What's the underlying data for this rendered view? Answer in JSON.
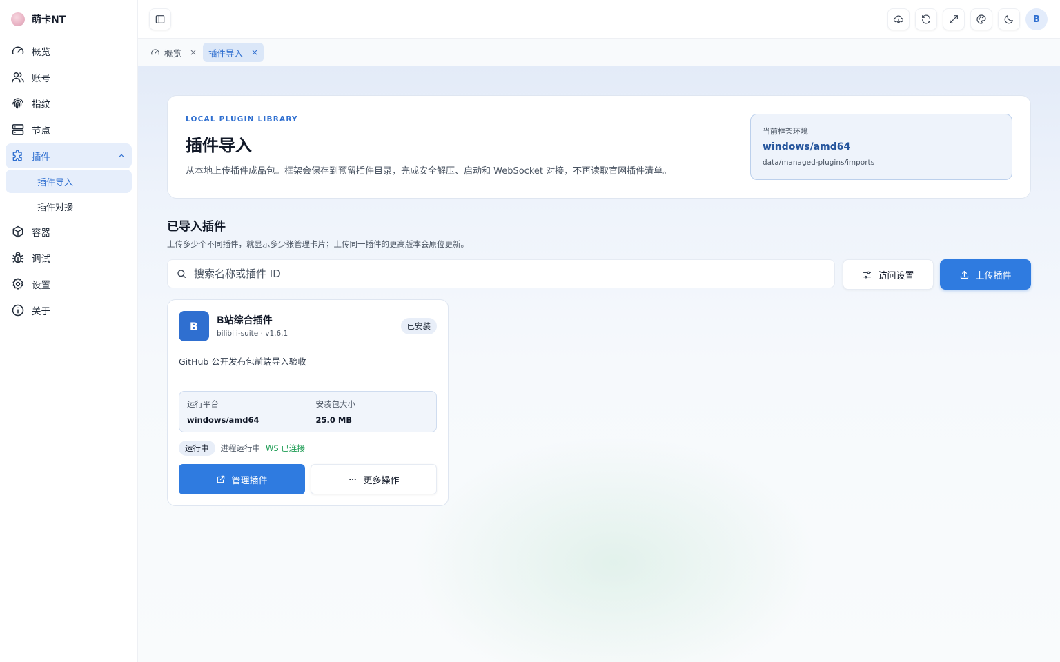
{
  "app": {
    "name": "萌卡NT"
  },
  "sidebar": {
    "items": [
      {
        "label": "概览",
        "icon": "gauge-icon"
      },
      {
        "label": "账号",
        "icon": "users-icon"
      },
      {
        "label": "指纹",
        "icon": "fingerprint-icon"
      },
      {
        "label": "节点",
        "icon": "server-icon"
      },
      {
        "label": "插件",
        "icon": "puzzle-icon",
        "expanded": true,
        "children": [
          {
            "label": "插件导入",
            "active": true
          },
          {
            "label": "插件对接"
          }
        ]
      },
      {
        "label": "容器",
        "icon": "box-icon"
      },
      {
        "label": "调试",
        "icon": "bug-icon"
      },
      {
        "label": "设置",
        "icon": "gear-icon"
      },
      {
        "label": "关于",
        "icon": "info-icon"
      }
    ]
  },
  "topbar": {
    "actions": [
      "cloud-download-icon",
      "refresh-icon",
      "fullscreen-icon",
      "palette-icon",
      "moon-icon"
    ],
    "avatar_letter": "B"
  },
  "tabs": [
    {
      "label": "概览",
      "close": "×",
      "active": false
    },
    {
      "label": "插件导入",
      "close": "×",
      "active": true
    }
  ],
  "hero": {
    "kicker": "LOCAL PLUGIN LIBRARY",
    "title": "插件导入",
    "description": "从本地上传插件成品包。框架会保存到预留插件目录，完成安全解压、启动和 WebSocket 对接，不再读取官网插件清单。",
    "env": {
      "label": "当前框架环境",
      "value": "windows/amd64",
      "path": "data/managed-plugins/imports"
    }
  },
  "section": {
    "title": "已导入插件",
    "description": "上传多少个不同插件，就显示多少张管理卡片；上传同一插件的更高版本会原位更新。"
  },
  "search": {
    "placeholder": "搜索名称或插件 ID",
    "value": ""
  },
  "buttons": {
    "access_settings": "访问设置",
    "upload_plugin": "上传插件"
  },
  "plugins": [
    {
      "logo_letter": "B",
      "name": "B站综合插件",
      "meta": "bilibili-suite · v1.6.1",
      "installed_badge": "已安装",
      "description": "GitHub 公开发布包前端导入验收",
      "platform_label": "运行平台",
      "platform": "windows/amd64",
      "size_label": "安装包大小",
      "size": "25.0 MB",
      "status": "运行中",
      "process_status": "进程运行中",
      "ws_status": "WS 已连接",
      "manage_label": "管理插件",
      "more_label": "更多操作"
    }
  ],
  "colors": {
    "accent": "#2f6fd0",
    "primary_button": "#2f7be0",
    "success": "#1f9d55"
  }
}
